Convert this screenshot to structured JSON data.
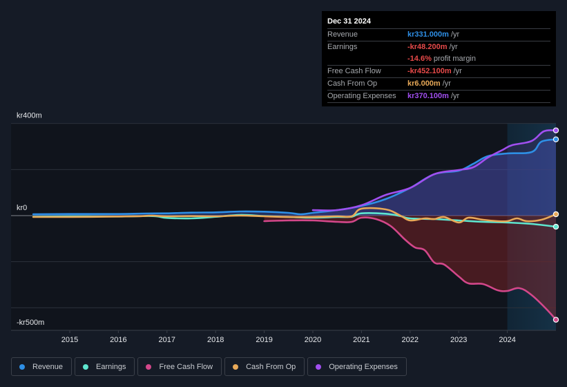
{
  "tooltip": {
    "date": "Dec 31 2024",
    "rows": [
      {
        "label": "Revenue",
        "value": "kr331.000m",
        "suffix": "/yr",
        "color": "#2e8fe6"
      },
      {
        "label": "Earnings",
        "value": "-kr48.200m",
        "suffix": "/yr",
        "color": "#e84a4a"
      },
      {
        "label": "",
        "value": "-14.6%",
        "suffix": "profit margin",
        "color": "#e84a4a"
      },
      {
        "label": "Free Cash Flow",
        "value": "-kr452.100m",
        "suffix": "/yr",
        "color": "#e84a4a"
      },
      {
        "label": "Cash From Op",
        "value": "kr6.000m",
        "suffix": "/yr",
        "color": "#e8a958"
      },
      {
        "label": "Operating Expenses",
        "value": "kr370.100m",
        "suffix": "/yr",
        "color": "#a14ff0"
      }
    ]
  },
  "legend": [
    {
      "label": "Revenue",
      "color": "#2e8fe6"
    },
    {
      "label": "Earnings",
      "color": "#5ee6cf"
    },
    {
      "label": "Free Cash Flow",
      "color": "#d3478a"
    },
    {
      "label": "Cash From Op",
      "color": "#e8a958"
    },
    {
      "label": "Operating Expenses",
      "color": "#a14ff0"
    }
  ],
  "chart_data": {
    "type": "line",
    "title": "",
    "xlabel": "",
    "ylabel": "",
    "currency_unit": "kr m",
    "y_tick_labels": [
      {
        "value": 400,
        "label": "kr400m"
      },
      {
        "value": 0,
        "label": "kr0"
      },
      {
        "value": -500,
        "label": "-kr500m"
      }
    ],
    "y_gridlines": [
      400,
      200,
      0,
      -200,
      -400
    ],
    "ylim": [
      -500,
      400
    ],
    "xlim": [
      2014.25,
      2025.0
    ],
    "x_ticks": [
      2015,
      2016,
      2017,
      2018,
      2019,
      2020,
      2021,
      2022,
      2023,
      2024
    ],
    "x_tick_labels": [
      "2015",
      "2016",
      "2017",
      "2018",
      "2019",
      "2020",
      "2021",
      "2022",
      "2023",
      "2024"
    ],
    "highlight_range": [
      2024.0,
      2025.0
    ],
    "grid": true,
    "legend_position": "bottom",
    "series": [
      {
        "name": "Revenue",
        "color": "#2e8fe6",
        "fill": true,
        "points": [
          [
            2014.25,
            6
          ],
          [
            2015,
            7
          ],
          [
            2016,
            7
          ],
          [
            2016.5,
            9
          ],
          [
            2017,
            10
          ],
          [
            2017.5,
            13
          ],
          [
            2018,
            14
          ],
          [
            2018.5,
            18
          ],
          [
            2019,
            17
          ],
          [
            2019.5,
            12
          ],
          [
            2019.75,
            6
          ],
          [
            2020,
            12
          ],
          [
            2020.5,
            24
          ],
          [
            2021,
            42
          ],
          [
            2021.5,
            72
          ],
          [
            2022,
            120
          ],
          [
            2022.5,
            180
          ],
          [
            2023,
            195
          ],
          [
            2023.3,
            225
          ],
          [
            2023.6,
            258
          ],
          [
            2024,
            270
          ],
          [
            2024.5,
            276
          ],
          [
            2024.7,
            321
          ],
          [
            2025,
            331
          ]
        ]
      },
      {
        "name": "Earnings",
        "color": "#5ee6cf",
        "fill": false,
        "points": [
          [
            2014.25,
            -5
          ],
          [
            2015,
            -3
          ],
          [
            2016,
            -4
          ],
          [
            2016.7,
            -2
          ],
          [
            2017,
            -10
          ],
          [
            2017.5,
            -12
          ],
          [
            2018,
            -5
          ],
          [
            2018.5,
            3
          ],
          [
            2019,
            -2
          ],
          [
            2019.5,
            -6
          ],
          [
            2020,
            -9
          ],
          [
            2020.5,
            -6
          ],
          [
            2020.8,
            -5
          ],
          [
            2021,
            10
          ],
          [
            2021.5,
            8
          ],
          [
            2021.8,
            -2
          ],
          [
            2022,
            -12
          ],
          [
            2022.5,
            -15
          ],
          [
            2023,
            -21
          ],
          [
            2023.5,
            -27
          ],
          [
            2024,
            -30
          ],
          [
            2024.5,
            -36
          ],
          [
            2025,
            -48.2
          ]
        ]
      },
      {
        "name": "Free Cash Flow",
        "color": "#d3478a",
        "fill": true,
        "points": [
          [
            2019,
            -24
          ],
          [
            2019.5,
            -21
          ],
          [
            2020,
            -21
          ],
          [
            2020.5,
            -27
          ],
          [
            2020.8,
            -27
          ],
          [
            2021,
            -9
          ],
          [
            2021.3,
            -15
          ],
          [
            2021.6,
            -45
          ],
          [
            2021.9,
            -105
          ],
          [
            2022.1,
            -138
          ],
          [
            2022.3,
            -150
          ],
          [
            2022.5,
            -204
          ],
          [
            2022.7,
            -212
          ],
          [
            2023,
            -264
          ],
          [
            2023.2,
            -294
          ],
          [
            2023.5,
            -297
          ],
          [
            2023.8,
            -324
          ],
          [
            2024,
            -327
          ],
          [
            2024.25,
            -315
          ],
          [
            2024.5,
            -345
          ],
          [
            2024.8,
            -405
          ],
          [
            2025,
            -452.1
          ]
        ]
      },
      {
        "name": "Cash From Op",
        "color": "#e8a958",
        "fill": false,
        "points": [
          [
            2014.25,
            -6
          ],
          [
            2015,
            -6
          ],
          [
            2016,
            -4
          ],
          [
            2016.5,
            -2
          ],
          [
            2016.7,
            0
          ],
          [
            2017,
            -3
          ],
          [
            2017.5,
            -2
          ],
          [
            2018,
            -3
          ],
          [
            2018.5,
            0
          ],
          [
            2019,
            -3
          ],
          [
            2019.5,
            -6
          ],
          [
            2020,
            -6
          ],
          [
            2020.5,
            -3
          ],
          [
            2020.8,
            -3
          ],
          [
            2021,
            30
          ],
          [
            2021.5,
            27
          ],
          [
            2021.8,
            0
          ],
          [
            2022,
            -21
          ],
          [
            2022.3,
            -12
          ],
          [
            2022.5,
            -15
          ],
          [
            2022.7,
            -6
          ],
          [
            2023,
            -30
          ],
          [
            2023.2,
            -9
          ],
          [
            2023.5,
            -18
          ],
          [
            2023.8,
            -24
          ],
          [
            2024,
            -24
          ],
          [
            2024.2,
            -12
          ],
          [
            2024.4,
            -24
          ],
          [
            2024.7,
            -18
          ],
          [
            2025,
            6
          ]
        ]
      },
      {
        "name": "Operating Expenses",
        "color": "#a14ff0",
        "fill": false,
        "points": [
          [
            2020,
            24
          ],
          [
            2020.5,
            24
          ],
          [
            2021,
            45
          ],
          [
            2021.5,
            90
          ],
          [
            2022,
            120
          ],
          [
            2022.5,
            180
          ],
          [
            2023,
            198
          ],
          [
            2023.3,
            210
          ],
          [
            2023.6,
            252
          ],
          [
            2023.9,
            285
          ],
          [
            2024.1,
            306
          ],
          [
            2024.5,
            324
          ],
          [
            2024.75,
            366
          ],
          [
            2025,
            370.1
          ]
        ]
      }
    ]
  }
}
